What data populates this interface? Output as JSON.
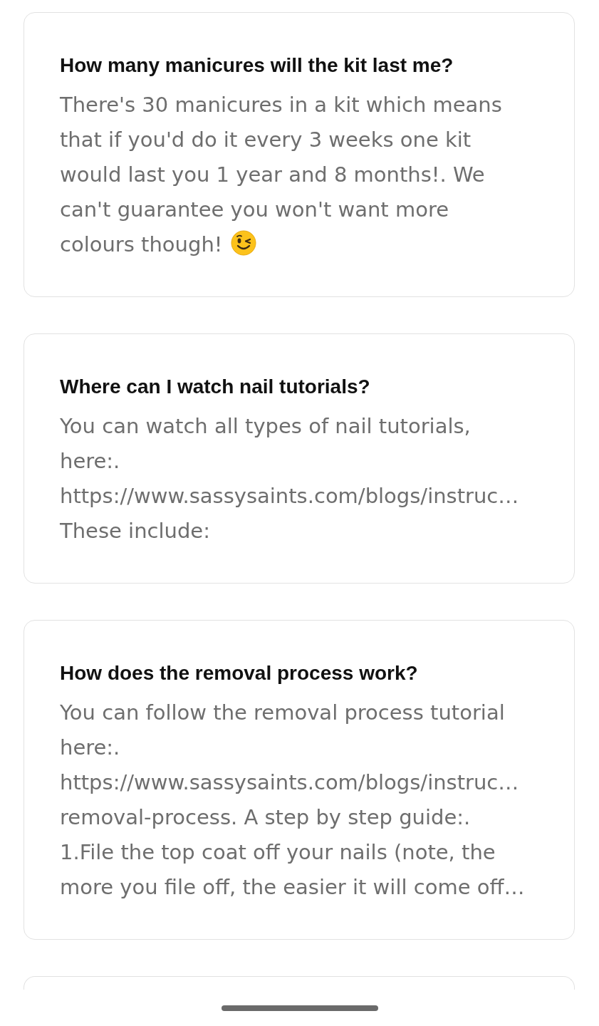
{
  "faqs": [
    {
      "question": "How many manicures will the kit last me?",
      "answer": "There's 30 manicures in a kit which means\nthat if you'd do it every 3 weeks one kit\nwould last you 1 year and 8 months!. We\ncan't guarantee you won't want more\ncolours though!",
      "emoji": true
    },
    {
      "question": "Where can I watch nail tutorials?",
      "answer": "You can watch all types of nail tutorials,\nhere:.\nhttps://www.sassysaints.com/blogs/instruc…\nThese include:",
      "emoji": false
    },
    {
      "question": "How does the removal process work?",
      "answer": "You can follow the removal process tutorial\nhere:.\nhttps://www.sassysaints.com/blogs/instruc…\nremoval-process. A step by step guide:.\n1.File the top coat off your nails (note, the\nmore you file off, the easier it will come off…",
      "emoji": false
    }
  ]
}
